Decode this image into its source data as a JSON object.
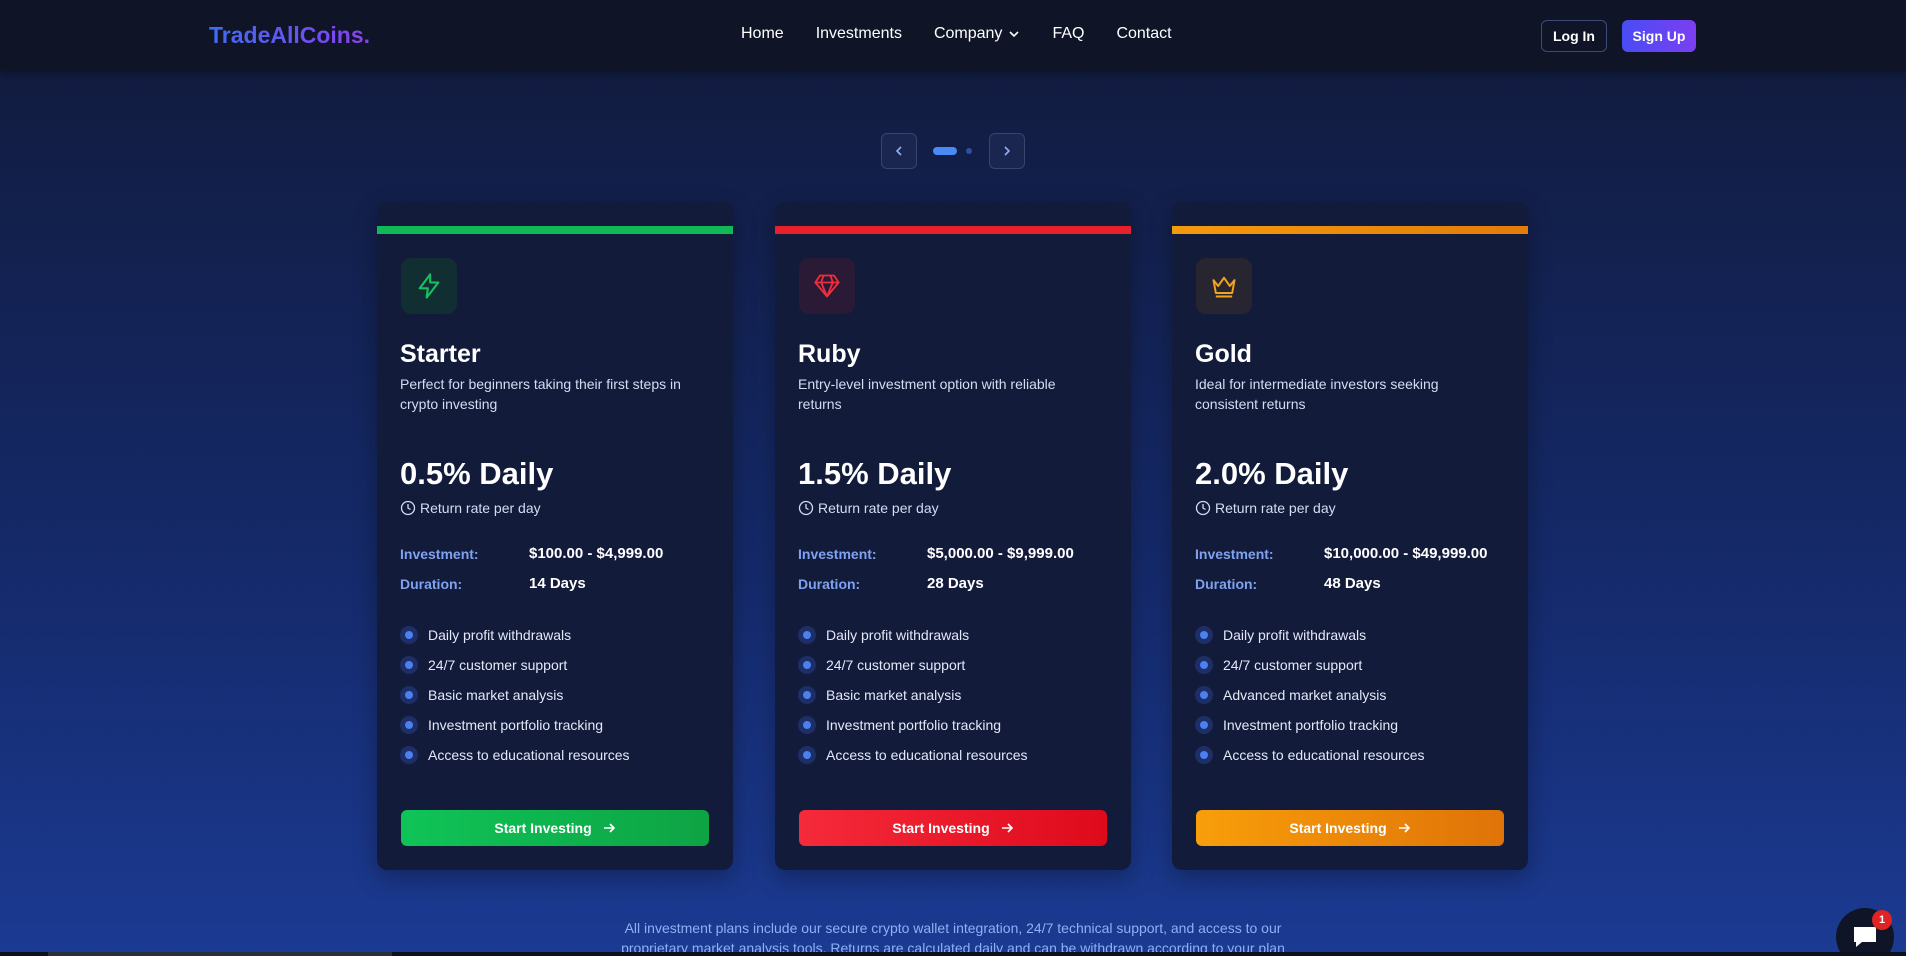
{
  "header": {
    "logo": "TradeAllCoins.",
    "nav": [
      "Home",
      "Investments",
      "Company",
      "FAQ",
      "Contact"
    ],
    "login_label": "Log In",
    "signup_label": "Sign Up"
  },
  "colors": {
    "starter_accent": "#11b858",
    "ruby_accent": "#e8202c",
    "gold_accent": "#f1920c",
    "brand_blue": "#4a4cf4"
  },
  "plans": [
    {
      "icon": "lightning-icon",
      "name": "Starter",
      "description": "Perfect for beginners taking their first steps in crypto investing",
      "rate": "0.5% Daily",
      "rate_sub": "Return rate per day",
      "investment_label": "Investment:",
      "investment_value": "$100.00 - $4,999.00",
      "duration_label": "Duration:",
      "duration_value": "14 Days",
      "features": [
        "Daily profit withdrawals",
        "24/7 customer support",
        "Basic market analysis",
        "Investment portfolio tracking",
        "Access to educational resources"
      ],
      "cta": "Start Investing"
    },
    {
      "icon": "gem-icon",
      "name": "Ruby",
      "description": "Entry-level investment option with reliable returns",
      "rate": "1.5% Daily",
      "rate_sub": "Return rate per day",
      "investment_label": "Investment:",
      "investment_value": "$5,000.00 - $9,999.00",
      "duration_label": "Duration:",
      "duration_value": "28 Days",
      "features": [
        "Daily profit withdrawals",
        "24/7 customer support",
        "Basic market analysis",
        "Investment portfolio tracking",
        "Access to educational resources"
      ],
      "cta": "Start Investing"
    },
    {
      "icon": "crown-icon",
      "name": "Gold",
      "description": "Ideal for intermediate investors seeking consistent returns",
      "rate": "2.0% Daily",
      "rate_sub": "Return rate per day",
      "investment_label": "Investment:",
      "investment_value": "$10,000.00 - $49,999.00",
      "duration_label": "Duration:",
      "duration_value": "48 Days",
      "features": [
        "Daily profit withdrawals",
        "24/7 customer support",
        "Advanced market analysis",
        "Investment portfolio tracking",
        "Access to educational resources"
      ],
      "cta": "Start Investing"
    }
  ],
  "footer_note_line1": "All investment plans include our secure crypto wallet integration, 24/7 technical support, and access to our",
  "footer_note_line2": "proprietary market analysis tools. Returns are calculated daily and can be withdrawn according to your plan",
  "chat": {
    "badge": "1"
  }
}
